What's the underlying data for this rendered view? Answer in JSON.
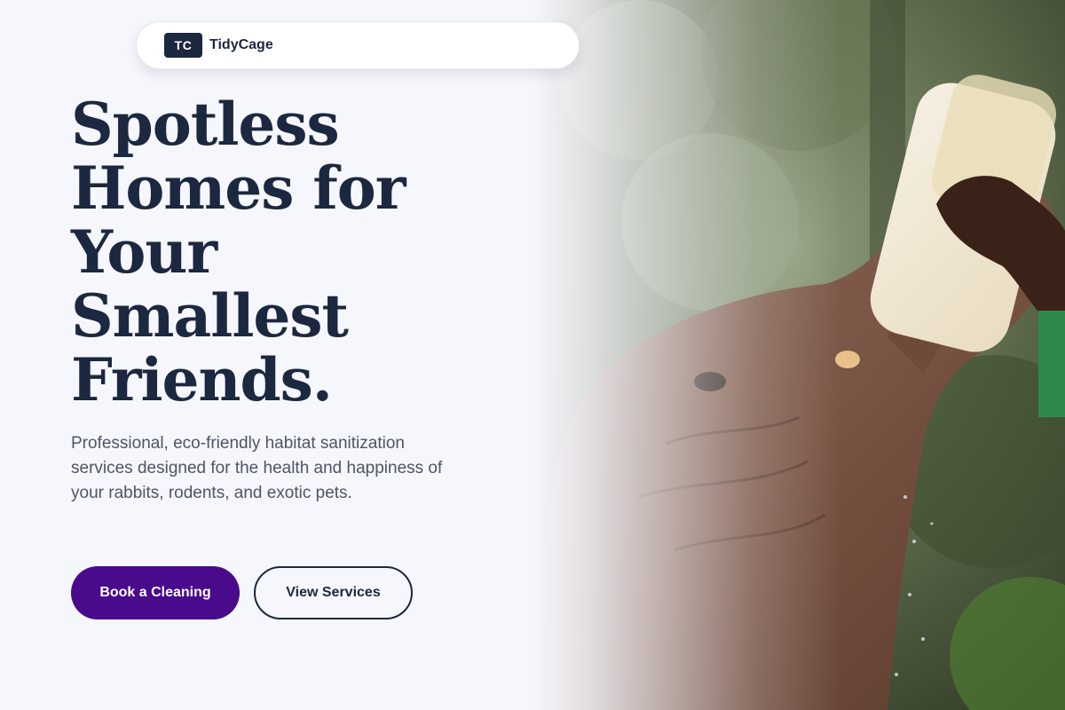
{
  "nav": {
    "logo_initials": "TC",
    "brand": "TidyCage"
  },
  "hero": {
    "headline_lines": [
      "Spotless",
      "Homes for",
      "Your",
      "Smallest",
      "Friends."
    ],
    "subtext": "Professional, eco-friendly habitat sanitization services designed for the health and happiness of your rabbits, rodents, and exotic pets.",
    "primary_cta": "Book a Cleaning",
    "secondary_cta": "View Services",
    "image_subject": "elephant-drinking-from-bottle-photo"
  },
  "colors": {
    "page_bg": "#f6f7fc",
    "navy": "#1c2740",
    "accent_purple": "#4a0a8c",
    "body_text": "#4d5566"
  }
}
